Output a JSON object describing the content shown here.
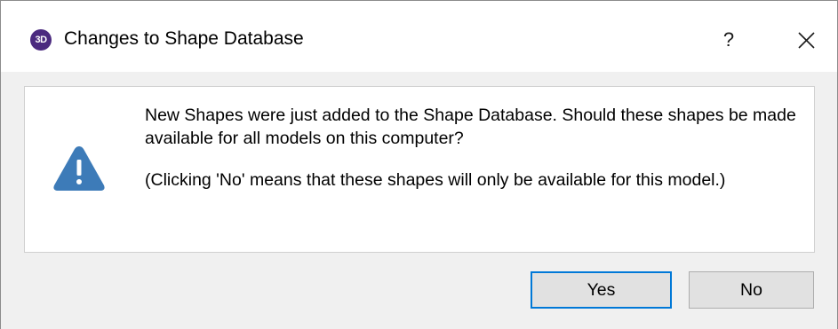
{
  "window": {
    "app_icon_text": "3D",
    "title": "Changes to Shape Database",
    "help_label": "?",
    "close_icon": "close-icon"
  },
  "message": {
    "icon": "warning-icon",
    "line1": "New Shapes were just added to the Shape Database. Should these shapes be made available for all models on this computer?",
    "line2": "(Clicking 'No' means that these shapes will only be available for this model.)"
  },
  "buttons": {
    "yes_label": "Yes",
    "no_label": "No"
  },
  "colors": {
    "accent": "#0078d7",
    "warning_icon": "#3d7bb8",
    "app_icon": "#4b2a7f"
  }
}
